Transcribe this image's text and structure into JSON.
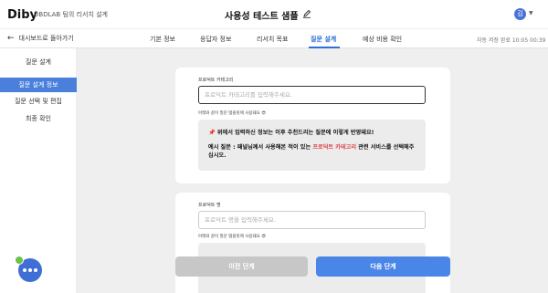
{
  "header": {
    "logo": "Diby",
    "brand": "DBDLAB 팀의 리서치 설계",
    "title": "사용성 테스트 샘플",
    "avatar_initial": "김"
  },
  "subnav": {
    "back_label": "대시보드로 돌아가기",
    "tabs": [
      "기본 정보",
      "응답자 정보",
      "리서치 목표",
      "질문 설계",
      "예상 비용 확인"
    ],
    "active_tab": "질문 설계",
    "autosave": "자동 저장 완료 10:05 00:39"
  },
  "sidebar": {
    "heading": "질문 설계",
    "items": [
      "질문 설계 정보",
      "질문 선택 및 편집",
      "최종 확인"
    ],
    "active_index": 0
  },
  "card1": {
    "label": "프로덕트 카테고리",
    "placeholder": "프로덕트 카테고리를 입력해주세요.",
    "hint": "아래와 같이 질문 템플릿에 사용돼요 😎",
    "example_line1": "📌 위에서 입력하신 정보는 이후 추천드리는 질문에 이렇게 반영돼요!",
    "example_prefix": "예시 질문 : 패널님께서 사용해본 적이 있는 ",
    "example_highlight": "프로덕트 카테고리",
    "example_suffix": " 관련 서비스를 선택해주십시오."
  },
  "card2": {
    "label": "프로덕트 명",
    "placeholder": "프로덕트 명을 입력해주세요.",
    "hint": "아래와 같이 질문 템플릿에 사용돼요 😎"
  },
  "buttons": {
    "prev": "이전 단계",
    "next": "다음 단계"
  },
  "colors": {
    "accent": "#2f6fd6",
    "highlight": "#e0444b",
    "sidebar_active": "#4a80dc"
  }
}
